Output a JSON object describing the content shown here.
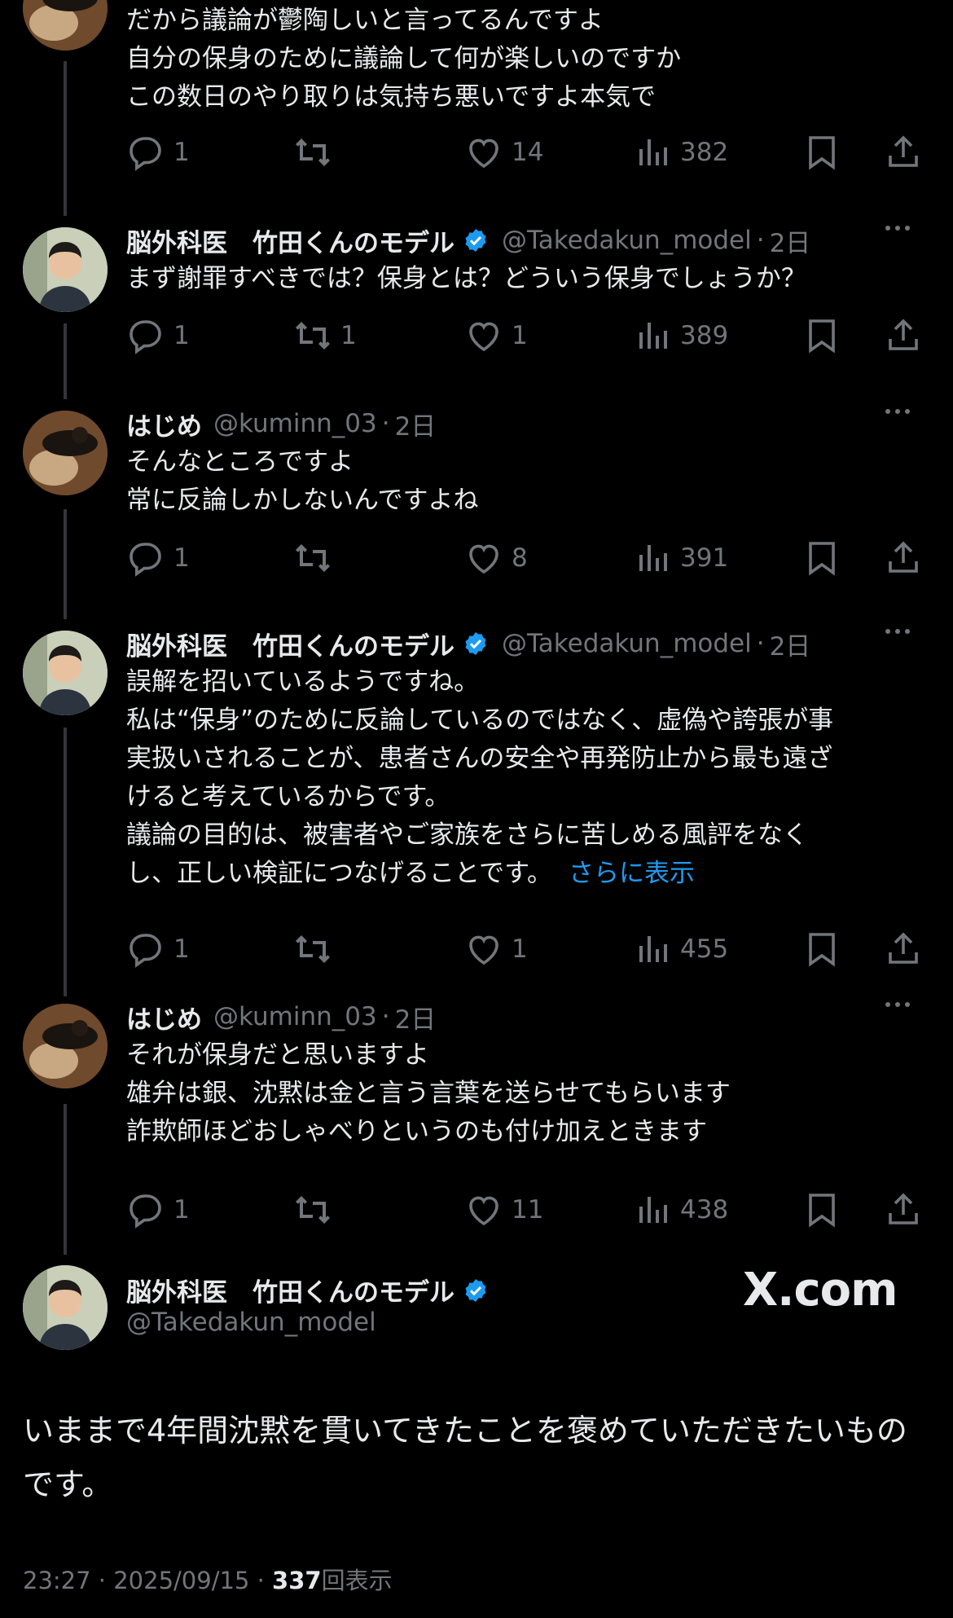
{
  "users": {
    "doctor": {
      "name": "脳外科医　竹田くんのモデル",
      "handle": "@Takedakun_model"
    },
    "hajime": {
      "name": "はじめ",
      "handle": "@kuminn_03"
    }
  },
  "tweets": [
    {
      "lines": [
        "だから議論が鬱陶しいと言ってるんですよ",
        "自分の保身のために議論して何が楽しいのですか",
        "この数日のやり取りは気持ち悪いですよ本気で"
      ],
      "replies": "1",
      "reposts": "",
      "likes": "14",
      "views": "382"
    },
    {
      "time": "2日",
      "lines": [
        "まず謝罪すべきでは？保身とは？どういう保身でしょうか？"
      ],
      "replies": "1",
      "reposts": "1",
      "likes": "1",
      "views": "389"
    },
    {
      "time": "2日",
      "lines": [
        "そんなところですよ",
        "常に反論しかしないんですよね"
      ],
      "replies": "1",
      "reposts": "",
      "likes": "8",
      "views": "391"
    },
    {
      "time": "2日",
      "lines": [
        "誤解を招いているようですね。",
        "私は“保身”のために反論しているのではなく、虚偽や誇張が事",
        "実扱いされることが、患者さんの安全や再発防止から最も遠ざ",
        "けると考えているからです。",
        "議論の目的は、被害者やご家族をさらに苦しめる風評をなく",
        "し、正しい検証につなげることです。"
      ],
      "show_more": "さらに表示",
      "replies": "1",
      "reposts": "",
      "likes": "1",
      "views": "455"
    },
    {
      "time": "2日",
      "lines": [
        "それが保身だと思いますよ",
        "雄弁は銀、沈黙は金と言う言葉を送らせてもらいます",
        "詐欺師ほどおしゃべりというのも付け加えときます"
      ],
      "replies": "1",
      "reposts": "",
      "likes": "11",
      "views": "438"
    }
  ],
  "main_tweet": {
    "watermark": "X.com",
    "text": "いままで4年間沈黙を貫いてきたことを褒めていただきたいものです。",
    "timestamp": "23:27 · 2025/09/15 · ",
    "views_count": "337",
    "views_label": "回表示"
  },
  "colors": {
    "background": "#000000",
    "text": "#e7e9ea",
    "muted": "#71767b",
    "link": "#1d9bf0",
    "verified": "#1d9bf0"
  }
}
